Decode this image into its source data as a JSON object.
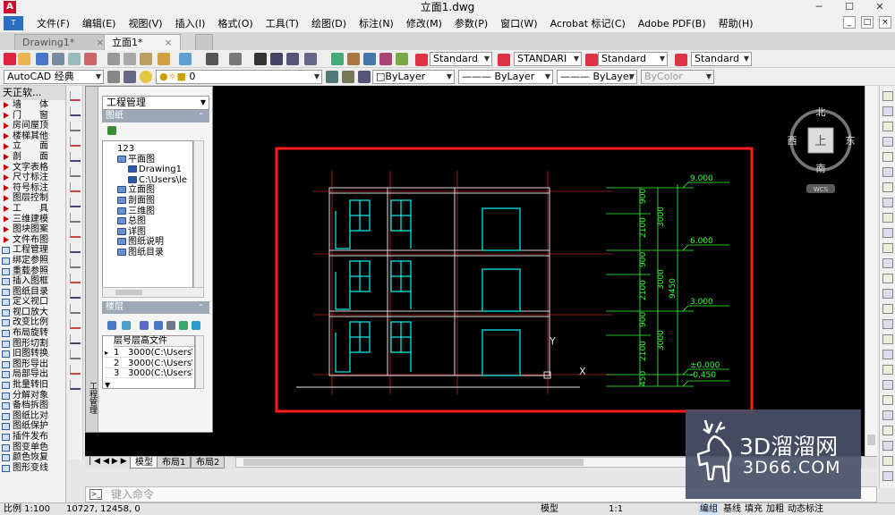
{
  "window": {
    "title": "立面1.dwg"
  },
  "menu": [
    "文件(F)",
    "编辑(E)",
    "视图(V)",
    "插入(I)",
    "格式(O)",
    "工具(T)",
    "绘图(D)",
    "标注(N)",
    "修改(M)",
    "参数(P)",
    "窗口(W)",
    "Acrobat 标记(C)",
    "Adobe PDF(B)",
    "帮助(H)"
  ],
  "doc_tabs": [
    {
      "label": "Drawing1*",
      "active": false
    },
    {
      "label": "立面1*",
      "active": true
    }
  ],
  "toolbar": {
    "styles": {
      "text": "Standard",
      "dim": "STANDARI",
      "table": "Standard",
      "mleader": "Standard"
    },
    "workspace": "AutoCAD 经典",
    "layer": "0",
    "color": "ByLayer",
    "linetype": "ByLayer",
    "lineweight": "ByLayer",
    "plotstyle": "ByColor"
  },
  "tianzheng": {
    "title": "天正软...",
    "items": [
      "墙　　体",
      "门　　窗",
      "房间屋顶",
      "楼梯其他",
      "立　　面",
      "剖　　面",
      "文字表格",
      "尺寸标注",
      "符号标注",
      "图层控制",
      "工　　具",
      "三维建模",
      "图块图案",
      "文件布图"
    ],
    "sub_items": [
      "工程管理",
      "绑定参照",
      "重载参照",
      "插入图框",
      "图纸目录",
      "定义视口",
      "视口放大",
      "改变比例",
      "布局旋转",
      "图形切割",
      "旧图转换",
      "图形导出",
      "局部导出",
      "批量转旧",
      "分解对象",
      "备档拆图",
      "图纸比对",
      "图纸保护",
      "插件发布",
      "图变单色",
      "颜色恢复",
      "图形变线"
    ]
  },
  "project_manager": {
    "strip_label": "工程管理",
    "select": "工程管理",
    "section_drawings": "图纸",
    "tree": [
      {
        "label": "123",
        "level": 0
      },
      {
        "label": "平面图",
        "level": 1
      },
      {
        "label": "Drawing1",
        "level": 2
      },
      {
        "label": "C:\\Users\\le",
        "level": 2
      },
      {
        "label": "立面图",
        "level": 1
      },
      {
        "label": "剖面图",
        "level": 1
      },
      {
        "label": "三维图",
        "level": 1
      },
      {
        "label": "总图",
        "level": 1
      },
      {
        "label": "详图",
        "level": 1
      },
      {
        "label": "图纸说明",
        "level": 1
      },
      {
        "label": "图纸目录",
        "level": 1
      }
    ],
    "section_floors": "楼层",
    "floor_headers": [
      "层号",
      "层高",
      "文件"
    ],
    "floors": [
      {
        "no": "1",
        "height": "300",
        "file": "0(C:\\Users\\"
      },
      {
        "no": "2",
        "height": "300",
        "file": "0(C:\\Users\\"
      },
      {
        "no": "3",
        "height": "300",
        "file": "0(C:\\Users\\"
      }
    ]
  },
  "compass": {
    "north": "北",
    "south": "南",
    "east": "东",
    "west": "西",
    "top": "上",
    "wcs": "WCS"
  },
  "drawing": {
    "elevations": [
      "9.000",
      "6.000",
      "3.000",
      "±0.000",
      "-0.450"
    ],
    "dims_inner": [
      "900",
      "2100",
      "900",
      "2100",
      "900",
      "2100",
      "450"
    ],
    "dims_mid": [
      "3000",
      "3000",
      "3000"
    ],
    "dims_total": "9450",
    "ucs_y": "Y",
    "ucs_x": "X"
  },
  "layout_tabs": [
    "模型",
    "布局1",
    "布局2"
  ],
  "command": {
    "placeholder": "键入命令"
  },
  "status": {
    "scale": "比例 1:100",
    "coords": "10727, 12458, 0",
    "model": "模型",
    "annoscale": "1:1",
    "buttons": [
      "编组",
      "基线",
      "填充",
      "加粗",
      "动态标注"
    ]
  },
  "watermark": {
    "brand": "3D溜溜网",
    "url": "3D66.COM"
  },
  "colors": {
    "cad_bg": "#000000",
    "frame_red": "#ff1a1a",
    "cyan": "#00e5e5",
    "green": "#33ff33",
    "red_axis": "#ff3030"
  }
}
